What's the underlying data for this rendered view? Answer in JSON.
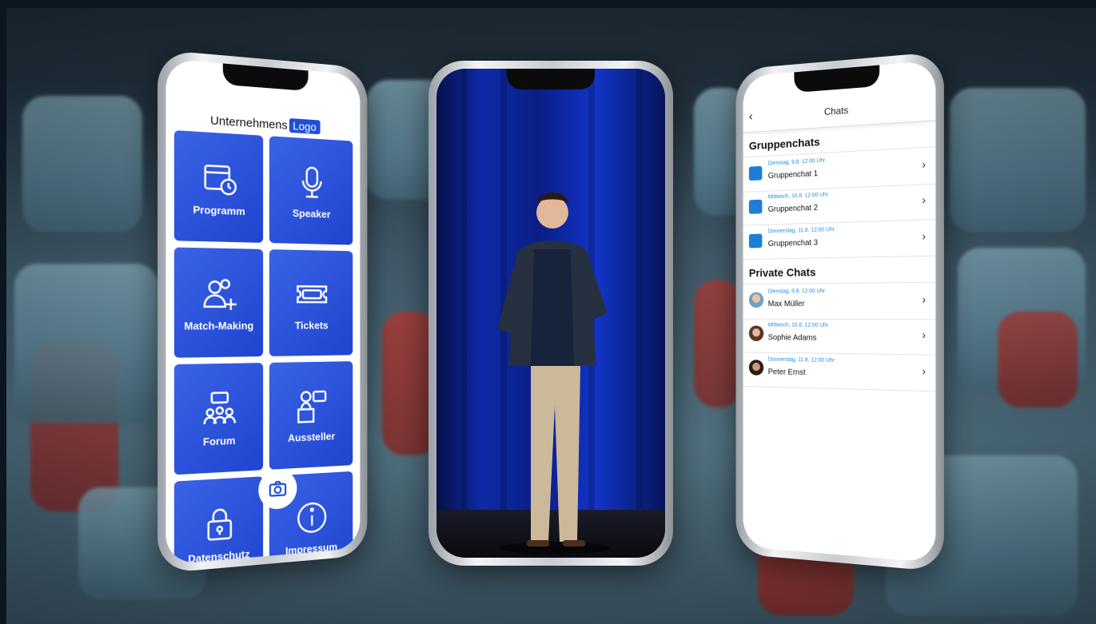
{
  "left_phone": {
    "brand_text": "Unternehmens",
    "brand_logo": "Logo",
    "tiles": [
      {
        "label": "Programm",
        "icon": "calendar-clock-icon"
      },
      {
        "label": "Speaker",
        "icon": "microphone-icon"
      },
      {
        "label": "Match-Making",
        "icon": "add-users-icon"
      },
      {
        "label": "Tickets",
        "icon": "ticket-icon"
      },
      {
        "label": "Forum",
        "icon": "chat-group-icon"
      },
      {
        "label": "Aussteller",
        "icon": "presenter-icon"
      },
      {
        "label": "Datenschutz",
        "icon": "padlock-icon"
      },
      {
        "label": "Impressum",
        "icon": "info-icon"
      }
    ],
    "accent": "#1f4fd6"
  },
  "right_phone": {
    "header_title": "Chats",
    "group_section": "Gruppenchats",
    "groups": [
      {
        "date": "Dienstag, 9.8. 12:00 Uhr",
        "name": "Gruppenchat 1"
      },
      {
        "date": "Mittwoch, 10.8. 12:00 Uhr",
        "name": "Gruppenchat 2"
      },
      {
        "date": "Donnerstag, 11.8. 12:00 Uhr",
        "name": "Gruppenchat 3"
      }
    ],
    "private_section": "Private Chats",
    "privates": [
      {
        "date": "Dienstag, 9.8. 12:00 Uhr",
        "name": "Max Müller"
      },
      {
        "date": "Mittwoch, 10.8. 12:00 Uhr",
        "name": "Sophie Adams"
      },
      {
        "date": "Donnerstag, 11.8. 12:00 Uhr",
        "name": "Peter Ernst"
      }
    ]
  }
}
